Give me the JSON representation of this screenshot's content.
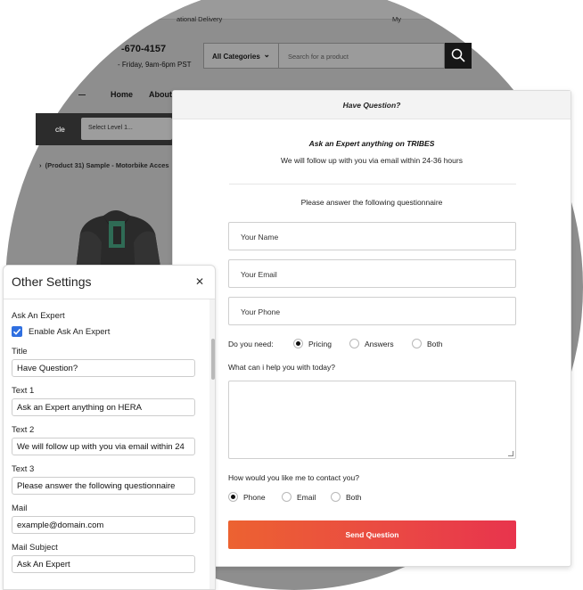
{
  "store": {
    "topbar_left": "ational Delivery",
    "topbar_right": "My",
    "phone": "-670-4157",
    "hours": "- Friday, 9am-6pm PST",
    "search_category": "All Categories",
    "search_placeholder": "Search for a product",
    "nav_home": "Home",
    "nav_about": "About",
    "dark_bar_text": "cle",
    "level_select": "Select Level 1...",
    "breadcrumb": "(Product 31) Sample - Motorbike Acces"
  },
  "modal": {
    "header": "Have Question?",
    "text1": "Ask an Expert anything on TRIBES",
    "text2": "We will follow up with you via email within 24-36 hours",
    "text3": "Please answer the following questionnaire",
    "name_placeholder": "Your Name",
    "email_placeholder": "Your Email",
    "phone_placeholder": "Your Phone",
    "need_label": "Do you need:",
    "need_options": [
      "Pricing",
      "Answers",
      "Both"
    ],
    "need_selected": "Pricing",
    "help_label": "What can i help you with today?",
    "contact_label": "How would you like me to contact you?",
    "contact_options": [
      "Phone",
      "Email",
      "Both"
    ],
    "contact_selected": "Phone",
    "send_label": "Send Question",
    "send_gradient": [
      "#ec6231",
      "#e8344d"
    ]
  },
  "settings": {
    "title": "Other Settings",
    "section": "Ask An Expert",
    "enable_label": "Enable Ask An Expert",
    "enable_checked": true,
    "fields": [
      {
        "label": "Title",
        "value": "Have Question?"
      },
      {
        "label": "Text 1",
        "value": "Ask an Expert anything on HERA"
      },
      {
        "label": "Text 2",
        "value": "We will follow up with you via email within 24"
      },
      {
        "label": "Text 3",
        "value": "Please answer the following questionnaire"
      },
      {
        "label": "Mail",
        "value": "example@domain.com"
      },
      {
        "label": "Mail Subject",
        "value": "Ask An Expert"
      }
    ],
    "accent_color": "#2f6fe0"
  }
}
